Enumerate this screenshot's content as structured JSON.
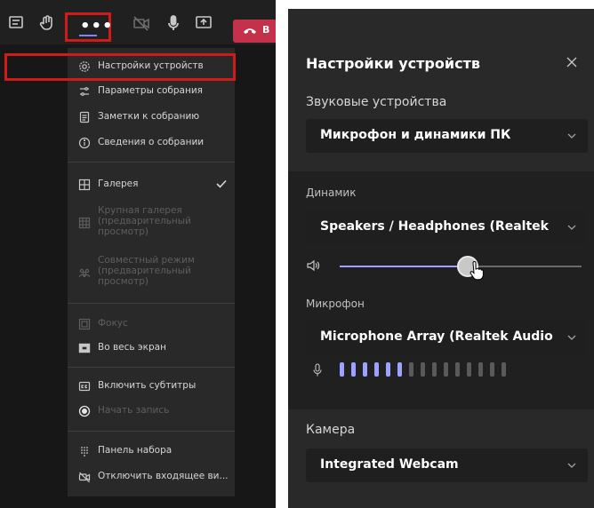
{
  "toolbar": {
    "more_dots": "•••",
    "leave_label": "В"
  },
  "menu": {
    "items": [
      {
        "label": "Настройки устройств",
        "icon": "gear-icon"
      },
      {
        "label": "Параметры собрания",
        "icon": "sliders-icon"
      },
      {
        "label": "Заметки к собранию",
        "icon": "notes-icon"
      },
      {
        "label": "Сведения о собрании",
        "icon": "info-icon"
      },
      {
        "label": "Галерея",
        "icon": "gallery-icon",
        "checked": true
      },
      {
        "label": "Крупная галерея (предварительный просмотр)",
        "icon": "large-gallery-icon",
        "disabled": true
      },
      {
        "label": "Совместный режим (предварительный просмотр)",
        "icon": "together-mode-icon",
        "disabled": true
      },
      {
        "label": "Фокус",
        "icon": "focus-icon",
        "disabled": true
      },
      {
        "label": "Во весь экран",
        "icon": "fullscreen-icon"
      },
      {
        "label": "Включить субтитры",
        "icon": "captions-icon"
      },
      {
        "label": "Начать запись",
        "icon": "record-icon",
        "disabled": true
      },
      {
        "label": "Панель набора",
        "icon": "dialpad-icon"
      },
      {
        "label": "Отключить входящее ви...",
        "icon": "video-off-icon"
      }
    ]
  },
  "settings": {
    "title": "Настройки устройств",
    "audio_devices_label": "Звуковые устройства",
    "audio_devices_value": "Микрофон и динамики ПК",
    "speaker_label": "Динамик",
    "speaker_value": "Speakers / Headphones (Realtek ...",
    "speaker_volume": 0.53,
    "mic_label": "Микрофон",
    "mic_value": "Microphone Array (Realtek Audio)",
    "mic_level_bars_total": 15,
    "mic_level_bars_active": 6,
    "camera_label": "Камера",
    "camera_value": "Integrated Webcam"
  },
  "colors": {
    "accent": "#9ea2ff",
    "highlight": "#d11b1b",
    "leave": "#c4314b"
  }
}
